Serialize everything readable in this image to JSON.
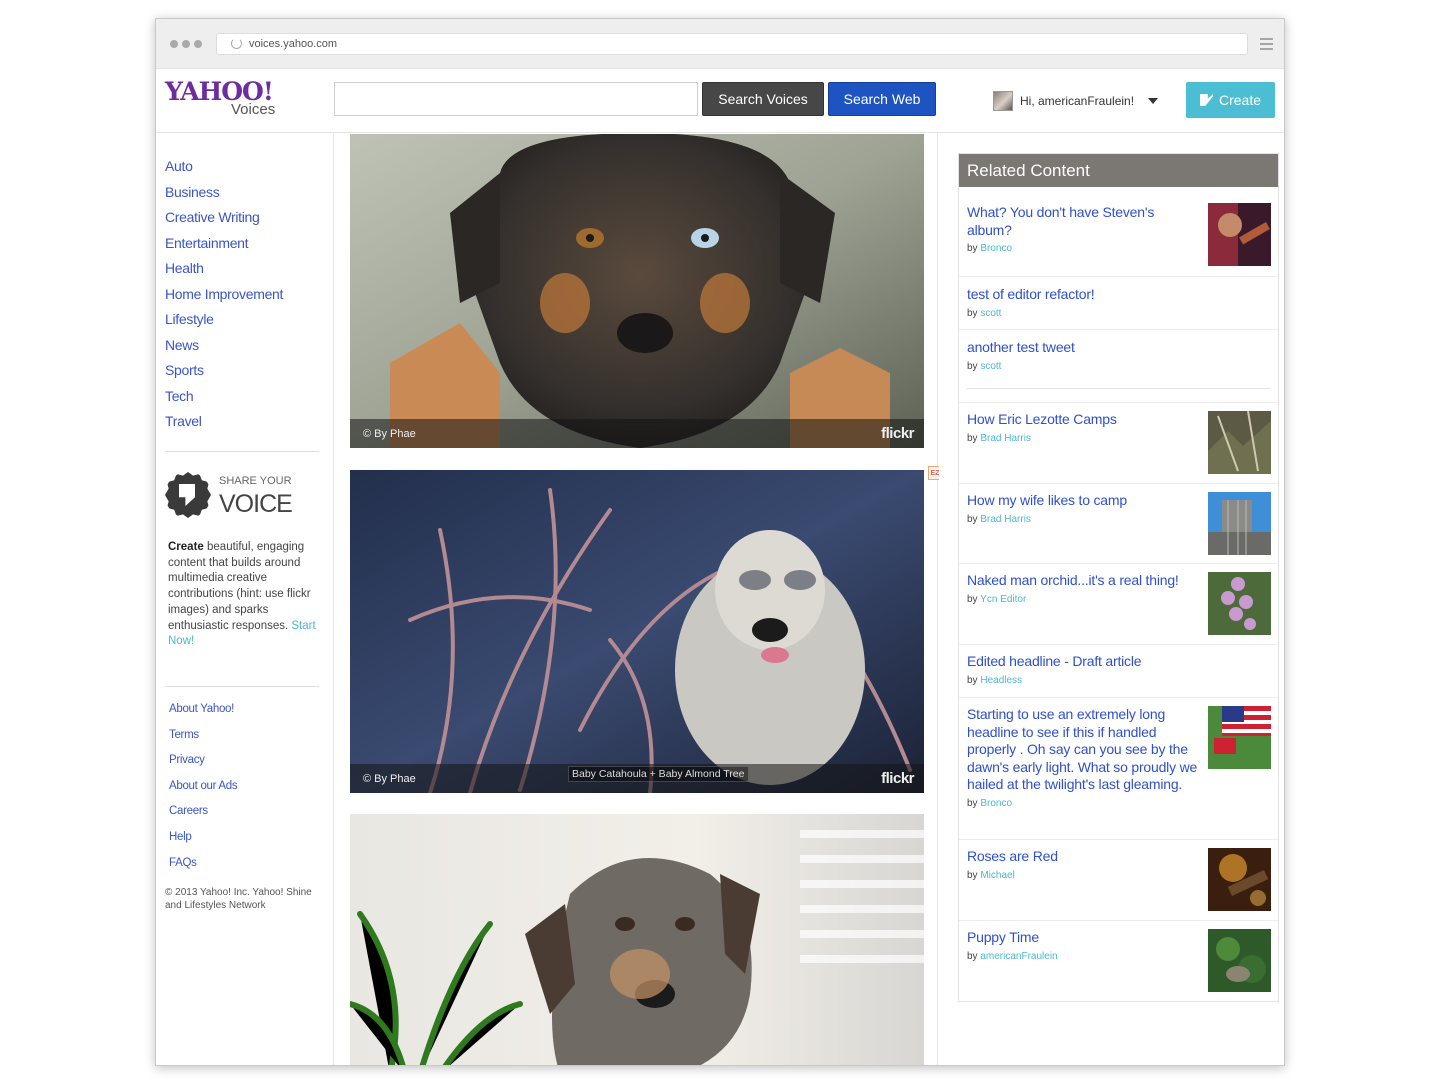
{
  "browser": {
    "url": "voices.yahoo.com"
  },
  "header": {
    "logo_main": "YAHOO!",
    "logo_sub": "Voices",
    "search_placeholder": "",
    "search_voices_label": "Search Voices",
    "search_web_label": "Search Web",
    "greeting": "Hi, americanFraulein!",
    "create_label": "Create"
  },
  "sidebar": {
    "categories": [
      "Auto",
      "Business",
      "Creative Writing",
      "Entertainment",
      "Health",
      "Home Improvement",
      "Lifestyle",
      "News",
      "Sports",
      "Tech",
      "Travel"
    ],
    "share": {
      "small": "SHARE YOUR",
      "big": "VOICE",
      "text_bold": "Create",
      "text_rest": " beautiful, engaging content that builds around multimedia creative contributions (hint: use flickr images) and sparks enthusiastic responses.",
      "link": "Start Now!"
    },
    "footer_links": [
      "About Yahoo!",
      "Terms",
      "Privacy",
      "About our Ads",
      "Careers",
      "Help",
      "FAQs"
    ],
    "copyright": "© 2013  Yahoo! Inc. Yahoo! Shine and Lifestyles Network"
  },
  "photos": [
    {
      "credit": "© By Phae",
      "source": "flickr",
      "title": ""
    },
    {
      "credit": "© By Phae",
      "source": "flickr",
      "title": "Baby Catahoula + Baby Almond Tree"
    },
    {
      "credit": "",
      "source": "",
      "title": ""
    }
  ],
  "ez_badge": "EZ",
  "related": {
    "heading": "Related Content",
    "by_prefix": "by",
    "items": [
      {
        "title": "What? You don't have Steven's album?",
        "author": "Bronco"
      },
      {
        "title": "test of editor refactor!",
        "author": "scott"
      },
      {
        "title": "another test tweet",
        "author": "scott"
      },
      {
        "title": "How Eric Lezotte Camps",
        "author": "Brad Harris"
      },
      {
        "title": "How my wife likes to camp",
        "author": "Brad Harris"
      },
      {
        "title": "Naked man orchid...it's a real thing!",
        "author": "Ycn Editor"
      },
      {
        "title": "Edited headline - Draft article",
        "author": "Headless"
      },
      {
        "title": "Starting to use an extremely long headline to see if this if handled properly . Oh say can you see by the dawn's early light. What so proudly we hailed at the twilight's last gleaming.",
        "author": "Bronco"
      },
      {
        "title": "Roses are Red",
        "author": "Michael"
      },
      {
        "title": "Puppy Time",
        "author": "americanFraulein"
      }
    ]
  },
  "colors": {
    "logo_purple": "#6d2c9f",
    "link_blue": "#3a55c8",
    "author_teal": "#4bb8cf",
    "search_web_blue": "#1e53c2",
    "create_teal": "#4bbed3",
    "related_header": "#7b7772"
  }
}
